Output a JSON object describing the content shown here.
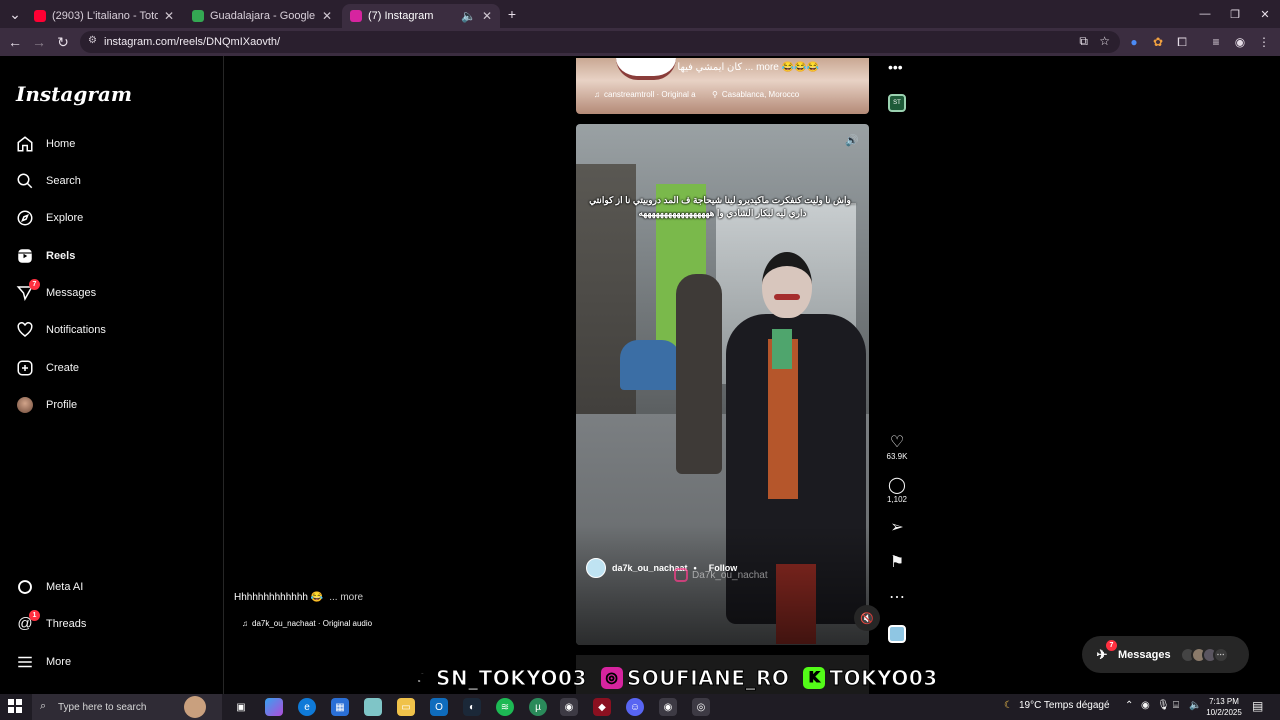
{
  "browser": {
    "tabs": [
      {
        "title": "(2903) L'italiano - Toto Cutugno",
        "fav_color": "#ff0033",
        "active": false
      },
      {
        "title": "Guadalajara - Google Maps",
        "fav_color": "#34a853",
        "active": false
      },
      {
        "title": "(7) Instagram",
        "fav_color": "#d6249f",
        "active": true
      }
    ],
    "url": "instagram.com/reels/DNQmIXaovth/"
  },
  "sidebar": {
    "logo": "Instagram",
    "items": [
      {
        "label": "Home",
        "icon": "home-icon"
      },
      {
        "label": "Search",
        "icon": "search-icon"
      },
      {
        "label": "Explore",
        "icon": "compass-icon"
      },
      {
        "label": "Reels",
        "icon": "reels-icon",
        "active": true
      },
      {
        "label": "Messages",
        "icon": "messenger-icon",
        "badge": "7"
      },
      {
        "label": "Notifications",
        "icon": "heart-icon"
      },
      {
        "label": "Create",
        "icon": "plus-square-icon"
      },
      {
        "label": "Profile",
        "icon": "avatar"
      }
    ],
    "bottom_items": [
      {
        "label": "Meta AI",
        "icon": "meta-ai-icon"
      },
      {
        "label": "Threads",
        "icon": "threads-icon",
        "badge": "1"
      },
      {
        "label": "More",
        "icon": "hamburger-icon"
      }
    ]
  },
  "prev_reel": {
    "caption": "كان ايمشي فيها ... more 😂😂😂",
    "audio": "canstreamtroll · Original a",
    "location": "Casablanca, Morocco"
  },
  "reel": {
    "overlay_text": "_واش نا وليت كنفكرت ماكيديرو لينا شيحاجة ف المد دروبيتي نا از كوانتي داري ليه لبكار الشادي وا هههههههههههههههههه",
    "author": "da7k_ou_nachaat",
    "follow_label": "Follow",
    "watermark": "Da7k_ou_nachat",
    "caption": "Hhhhhhhhhhhhh 😂",
    "caption_more": "... more",
    "audio": "da7k_ou_nachaat · Original audio"
  },
  "actions": {
    "likes": "63.9K",
    "comments": "1,102"
  },
  "messages_pill": {
    "label": "Messages",
    "badge": "7"
  },
  "stream_overlay": [
    {
      "handle": "SN_TOKYO03",
      "icon": "tiktok-icon",
      "color": "#000000"
    },
    {
      "handle": "SOUFIANE_RO",
      "icon": "instagram-icon",
      "color": "#d6249f"
    },
    {
      "handle": "TOKYO03",
      "icon": "kick-icon",
      "color": "#53fc18"
    }
  ],
  "taskbar": {
    "search_placeholder": "Type here to search",
    "weather": "19°C  Temps dégagé",
    "time": "7:13 PM",
    "date": "10/2/2025"
  }
}
